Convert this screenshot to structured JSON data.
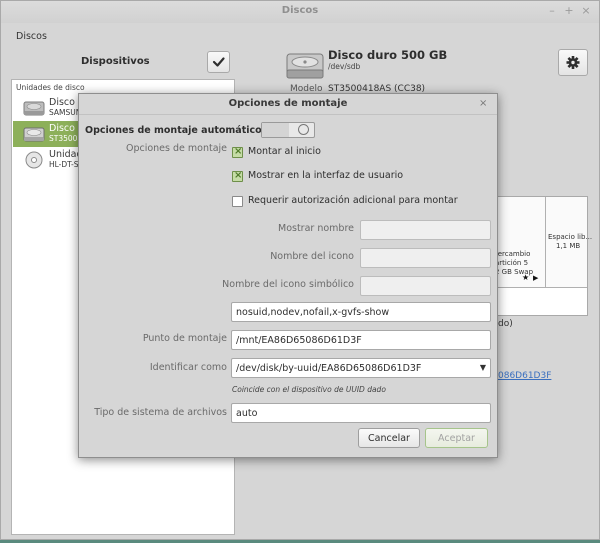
{
  "window": {
    "title": "Discos"
  },
  "menubar": {
    "app_menu": "Discos"
  },
  "sidebar": {
    "title": "Dispositivos",
    "group_label": "Unidades de disco",
    "devices": [
      {
        "name": "Disco d",
        "subtitle": "SAMSUN",
        "selected": false
      },
      {
        "name": "Disco d",
        "subtitle": "ST3500",
        "selected": true
      },
      {
        "name": "Unidad",
        "subtitle": "HL-DT-S",
        "selected": false
      }
    ]
  },
  "disk": {
    "title": "Disco duro 500 GB",
    "path": "/dev/sdb",
    "model_label": "Modelo",
    "model_value": "ST3500418AS (CC38)"
  },
  "volumes": {
    "partition_lines": [
      "tercambio",
      "artición 5",
      "2 GB Swap"
    ],
    "free_lines": [
      "Espacio lib...",
      "1,1 MB"
    ],
    "peek_text": "do)",
    "peek_link": "086D61D3F"
  },
  "dialog": {
    "title": "Opciones de montaje",
    "auto_label": "Opciones de montaje automático",
    "mount_options_label": "Opciones de montaje",
    "checkboxes": [
      {
        "label": "Montar al inicio",
        "checked": true
      },
      {
        "label": "Mostrar en la interfaz de usuario",
        "checked": true
      },
      {
        "label": "Requerir autorización adicional para montar",
        "checked": false
      }
    ],
    "show_name_label": "Mostrar nombre",
    "show_name_value": "",
    "icon_name_label": "Nombre del icono",
    "icon_name_value": "",
    "symbolic_icon_label": "Nombre del icono simbólico",
    "symbolic_icon_value": "",
    "options_value": "nosuid,nodev,nofail,x-gvfs-show",
    "mount_point_label": "Punto de montaje",
    "mount_point_value": "/mnt/EA86D65086D61D3F",
    "identify_label": "Identificar como",
    "identify_value": "/dev/disk/by-uuid/EA86D65086D61D3F",
    "identify_hint": "Coincide con el dispositivo de UUID dado",
    "fs_type_label": "Tipo de sistema de archivos",
    "fs_type_value": "auto",
    "cancel_label": "Cancelar",
    "accept_label": "Aceptar"
  },
  "colors": {
    "accent": "#8db05a",
    "link": "#3a6fbf",
    "check_fill": "#c5dca6"
  },
  "icons": {
    "check_button": "checkmark-icon",
    "gear_button": "gear-icon",
    "disk": "hard-disk-icon",
    "optical": "optical-disc-icon",
    "select": "chevron-down-icon",
    "close": "close-icon"
  }
}
